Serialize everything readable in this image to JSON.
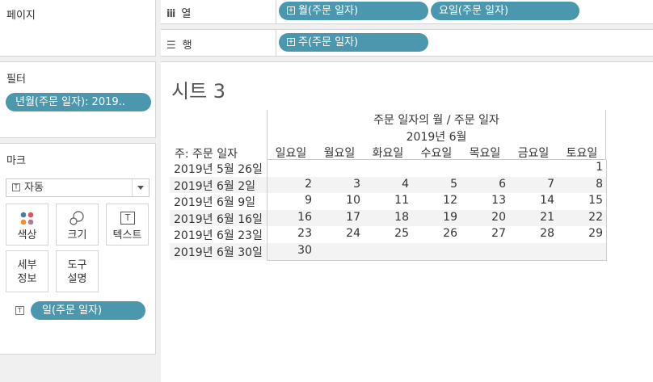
{
  "pages_card": {
    "title": "페이지"
  },
  "filters_card": {
    "title": "필터",
    "filter_pill": "년월(주문 일자): 2019.."
  },
  "marks_card": {
    "title": "마크",
    "mark_type": "자동",
    "buttons": {
      "color": "색상",
      "size": "크기",
      "text": "텍스트",
      "detail": [
        "세부",
        "정보"
      ],
      "tooltip": [
        "도구",
        "설명"
      ]
    },
    "text_pill": "일(주문 일자)"
  },
  "columns_shelf": {
    "label": "열",
    "pills": [
      "월(주문 일자)",
      "요일(주문 일자)"
    ]
  },
  "rows_shelf": {
    "label": "행",
    "pills": [
      "주(주문 일자)"
    ]
  },
  "sheet": {
    "title": "시트 3",
    "header_title": "주문 일자의 월 / 주문 일자",
    "month": "2019년 6월",
    "row_header": "주: 주문 일자",
    "weekdays": [
      "일요일",
      "월요일",
      "화요일",
      "수요일",
      "목요일",
      "금요일",
      "토요일"
    ],
    "rows": [
      {
        "week": "2019년 5월 26일",
        "days": [
          "",
          "",
          "",
          "",
          "",
          "",
          "1"
        ]
      },
      {
        "week": "2019년 6월 2일",
        "days": [
          "2",
          "3",
          "4",
          "5",
          "6",
          "7",
          "8"
        ]
      },
      {
        "week": "2019년 6월 9일",
        "days": [
          "9",
          "10",
          "11",
          "12",
          "13",
          "14",
          "15"
        ]
      },
      {
        "week": "2019년 6월 16일",
        "days": [
          "16",
          "17",
          "18",
          "19",
          "20",
          "21",
          "22"
        ]
      },
      {
        "week": "2019년 6월 23일",
        "days": [
          "23",
          "24",
          "25",
          "26",
          "27",
          "28",
          "29"
        ]
      },
      {
        "week": "2019년 6월 30일",
        "days": [
          "30",
          "",
          "",
          "",
          "",
          "",
          ""
        ]
      }
    ]
  },
  "colors": {
    "pill": "#4b97ae",
    "band": "#f3f3f3"
  }
}
